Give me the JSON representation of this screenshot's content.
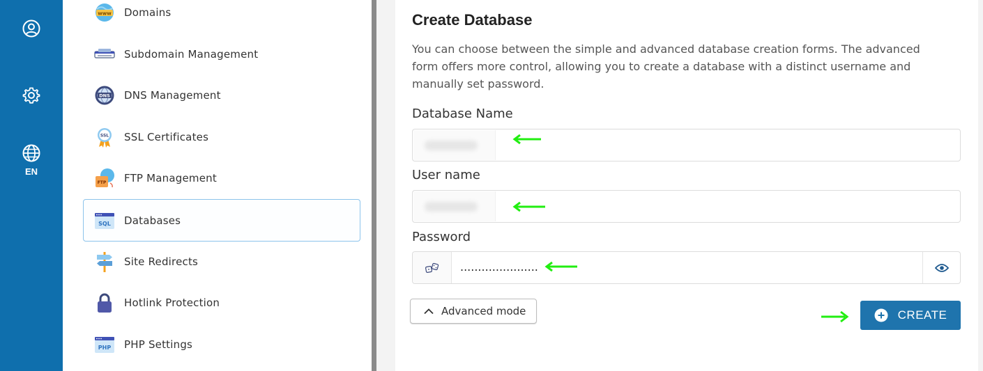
{
  "rail": {
    "language": "EN"
  },
  "menu": {
    "items": [
      {
        "label": "Domains"
      },
      {
        "label": "Subdomain Management"
      },
      {
        "label": "DNS Management"
      },
      {
        "label": "SSL Certificates"
      },
      {
        "label": "FTP Management"
      },
      {
        "label": "Databases",
        "active": true
      },
      {
        "label": "Site Redirects"
      },
      {
        "label": "Hotlink Protection"
      },
      {
        "label": "PHP Settings"
      }
    ],
    "icon_text": {
      "www": "www",
      "dns": "DNS",
      "ssl": "SSL",
      "ftp": "FTP",
      "sql": "SQL",
      "php": "PHP"
    }
  },
  "form": {
    "title": "Create Database",
    "description": "You can choose between the simple and advanced database creation forms. The advanced form offers more control, allowing you to create a database with a distinct username and manually set password.",
    "database_name_label": "Database Name",
    "user_name_label": "User name",
    "password_label": "Password",
    "password_value": "......................",
    "advanced_mode_label": "Advanced mode",
    "create_label": "CREATE"
  },
  "colors": {
    "rail": "#0f6fad",
    "accent": "#1f74ad",
    "active_border": "#8cc3eb",
    "annotation_arrow": "#22ee11"
  }
}
